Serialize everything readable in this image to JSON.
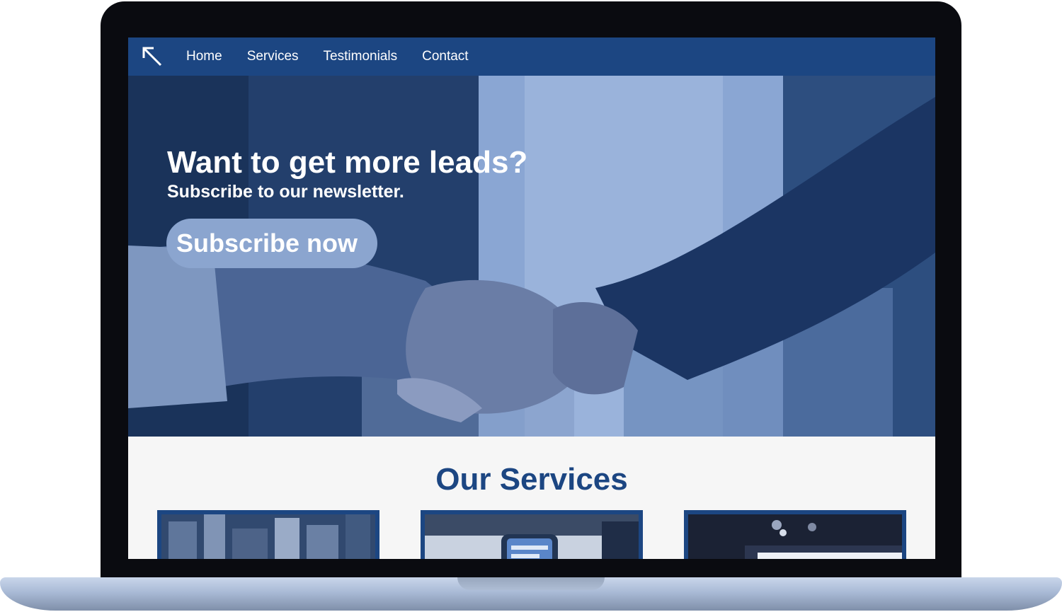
{
  "nav": {
    "logo_icon": "arrow-up-left-icon",
    "links": [
      "Home",
      "Services",
      "Testimonials",
      "Contact"
    ]
  },
  "hero": {
    "title": "Want to get more leads?",
    "subtitle": "Subscribe to our newsletter.",
    "cta_label": "Subscribe now",
    "image": "handshake-photo"
  },
  "services": {
    "title": "Our Services",
    "cards": [
      {
        "image": "city-aerial-photo"
      },
      {
        "image": "smartphone-photo"
      },
      {
        "image": "dark-office-photo"
      }
    ]
  },
  "colors": {
    "brand": "#1c4682",
    "cta": "#8ba5cf",
    "section_bg": "#f6f6f6"
  }
}
